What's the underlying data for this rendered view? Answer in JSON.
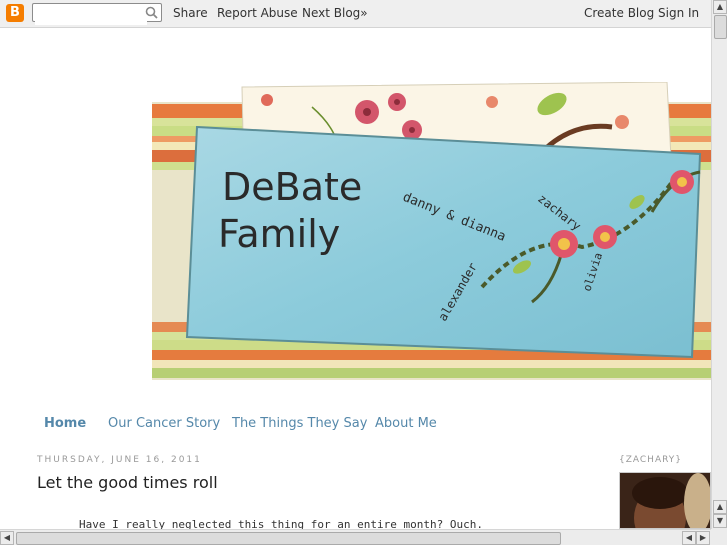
{
  "navbar": {
    "logo_letter": "B",
    "search_placeholder": "",
    "share": "Share",
    "report_abuse": "Report Abuse",
    "next_blog": "Next Blog»",
    "create_blog": "Create Blog",
    "sign_in": "Sign In"
  },
  "header": {
    "title_line1": "DeBate",
    "title_line2": "Family",
    "name_danny_dianna": "danny & dianna",
    "name_zachary": "zachary",
    "name_alexander": "alexander",
    "name_olivia": "olivia"
  },
  "tabs": [
    {
      "label": "Home"
    },
    {
      "label": "Our Cancer Story"
    },
    {
      "label": "The Things They Say"
    },
    {
      "label": "About Me"
    }
  ],
  "post": {
    "date": "THURSDAY, JUNE 16, 2011",
    "title": "Let the good times roll",
    "body_first_line": "Have I really neglected this thing for an entire month? Ouch."
  },
  "sidebar": {
    "title": "{ZACHARY}"
  },
  "colors": {
    "accent": "#5588aa",
    "blogger_orange": "#f57d00"
  }
}
